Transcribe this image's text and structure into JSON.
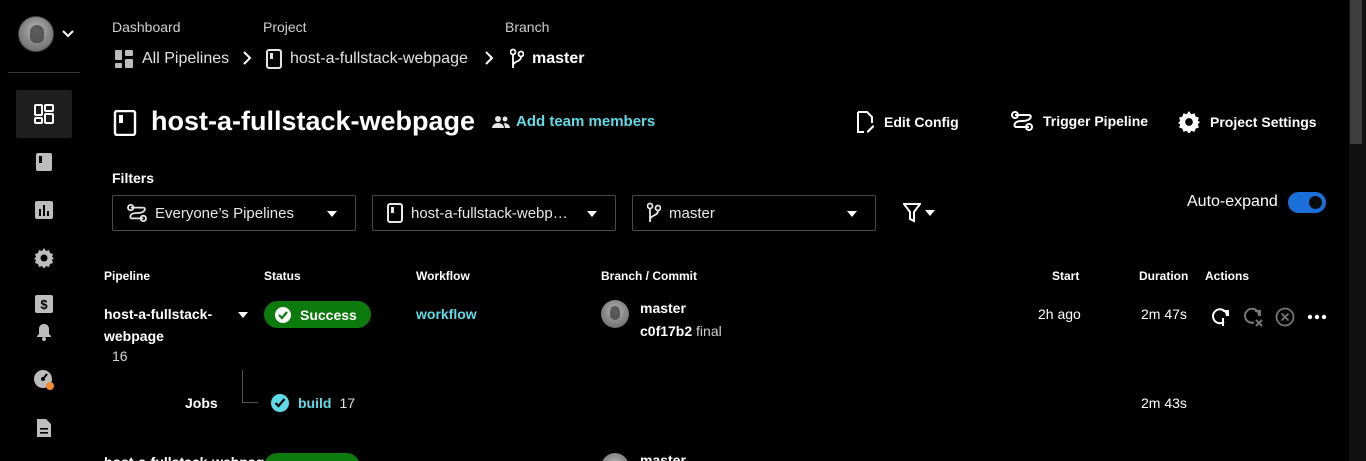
{
  "sidebar": {
    "avatar_alt": "user avatar",
    "items": [
      {
        "name": "dashboard",
        "icon": "dashboard-icon",
        "active": true
      },
      {
        "name": "projects",
        "icon": "project-icon",
        "active": false
      },
      {
        "name": "insights",
        "icon": "chart-icon",
        "active": false
      },
      {
        "name": "settings",
        "icon": "gear-icon",
        "active": false
      },
      {
        "name": "plan",
        "icon": "dollar-icon",
        "active": false
      },
      {
        "name": "notifications",
        "icon": "bell-icon",
        "active": false
      },
      {
        "name": "status",
        "icon": "gauge-icon",
        "active": false
      },
      {
        "name": "docs",
        "icon": "document-icon",
        "active": false
      }
    ]
  },
  "breadcrumb": {
    "dashboard_label": "Dashboard",
    "dashboard_value": "All Pipelines",
    "project_label": "Project",
    "project_value": "host-a-fullstack-webpage",
    "branch_label": "Branch",
    "branch_value": "master"
  },
  "header": {
    "title": "host-a-fullstack-webpage",
    "add_team": "Add team members",
    "edit_config": "Edit Config",
    "trigger_pipeline": "Trigger Pipeline",
    "project_settings": "Project Settings"
  },
  "filters": {
    "label": "Filters",
    "pipelines": "Everyone’s Pipelines",
    "project": "host-a-fullstack-webp…",
    "branch": "master",
    "auto_expand": "Auto-expand",
    "auto_expand_on": true
  },
  "table": {
    "headers": {
      "pipeline": "Pipeline",
      "status": "Status",
      "workflow": "Workflow",
      "branch_commit": "Branch / Commit",
      "start": "Start",
      "duration": "Duration",
      "actions": "Actions"
    },
    "rows": [
      {
        "pipeline": "host-a-fullstack-webpage",
        "number": "16",
        "status": "Success",
        "workflow": "workflow",
        "branch": "master",
        "commit": "c0f17b2",
        "commit_message": "final",
        "start": "2h ago",
        "duration": "2m 47s",
        "jobs_label": "Jobs",
        "job": {
          "name": "build",
          "number": "17",
          "duration": "2m 43s"
        }
      },
      {
        "pipeline": "host-a-fullstack-webpage",
        "branch": "master"
      }
    ]
  },
  "colors": {
    "accent_link": "#5fdbe8",
    "success": "#0d7a0d",
    "toggle": "#1a6fd8",
    "background": "#000000"
  }
}
